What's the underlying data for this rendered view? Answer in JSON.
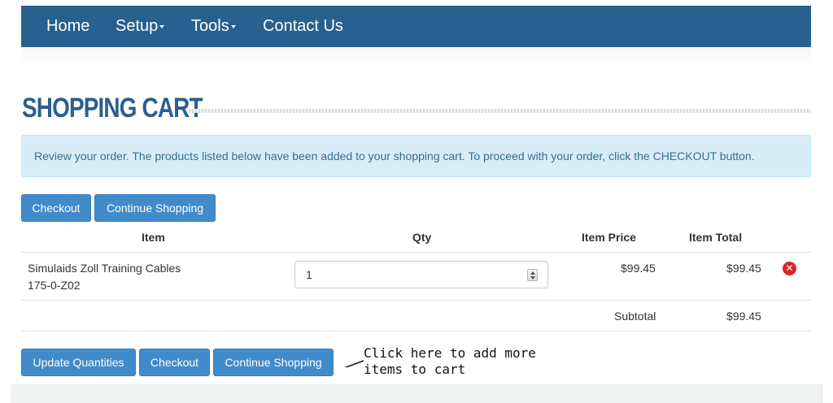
{
  "nav": {
    "items": [
      {
        "label": "Home"
      },
      {
        "label": "Setup",
        "dropdown": true
      },
      {
        "label": "Tools",
        "dropdown": true
      },
      {
        "label": "Contact Us"
      }
    ]
  },
  "page": {
    "title": "SHOPPING CART",
    "info": "Review your order. The products listed below have been added to your shopping cart. To proceed with your order, click the CHECKOUT button."
  },
  "top_buttons": {
    "checkout": "Checkout",
    "continue": "Continue Shopping"
  },
  "table": {
    "headers": {
      "item": "Item",
      "qty": "Qty",
      "price": "Item Price",
      "total": "Item Total"
    },
    "rows": [
      {
        "name": "Simulaids Zoll Training Cables",
        "sku": "175-0-Z02",
        "qty": "1",
        "price": "$99.45",
        "total": "$99.45"
      }
    ],
    "subtotal_label": "Subtotal",
    "subtotal_value": "$99.45"
  },
  "bottom_buttons": {
    "update": "Update Quantities",
    "checkout": "Checkout",
    "continue": "Continue Shopping"
  },
  "annotation": {
    "line1": "Click here to add more",
    "line2": "items to cart"
  },
  "colors": {
    "navbar": "#286090",
    "button": "#428bca",
    "title": "#2a5f8e",
    "info_bg": "#d9edf7",
    "remove": "#d9262a"
  },
  "icons": {
    "remove": "close-circle-icon",
    "caret": "caret-down-icon",
    "spinner": "spinner-arrows-icon"
  }
}
